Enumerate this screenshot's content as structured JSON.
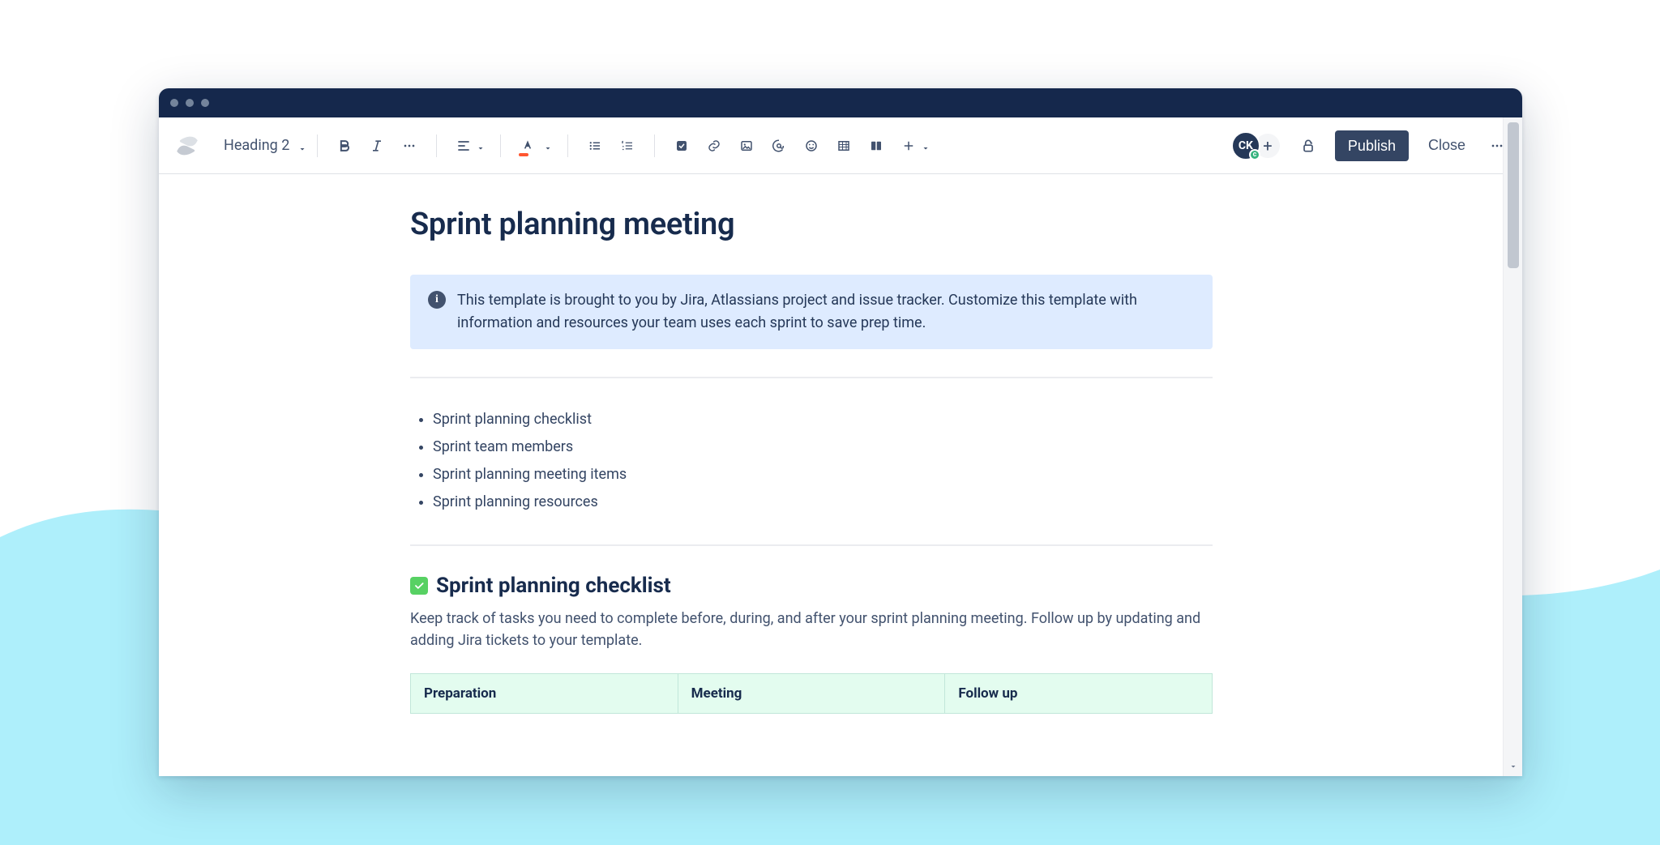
{
  "toolbar": {
    "heading_label": "Heading 2",
    "publish_label": "Publish",
    "close_label": "Close",
    "avatar_initials": "CK",
    "avatar_presence_char": "c"
  },
  "page": {
    "title": "Sprint planning meeting",
    "panel_text": "This template is brought to you by Jira, Atlassians project and issue tracker. Customize this template with information and resources your team uses each sprint to save prep time.",
    "toc": [
      "Sprint planning checklist",
      "Sprint team members",
      "Sprint planning meeting items",
      "Sprint planning resources"
    ],
    "section1": {
      "heading": "Sprint planning checklist",
      "desc": "Keep track of tasks you need to complete before, during, and after your sprint planning meeting. Follow up by updating and adding Jira tickets to your template.",
      "columns": [
        "Preparation",
        "Meeting",
        "Follow up"
      ]
    }
  }
}
